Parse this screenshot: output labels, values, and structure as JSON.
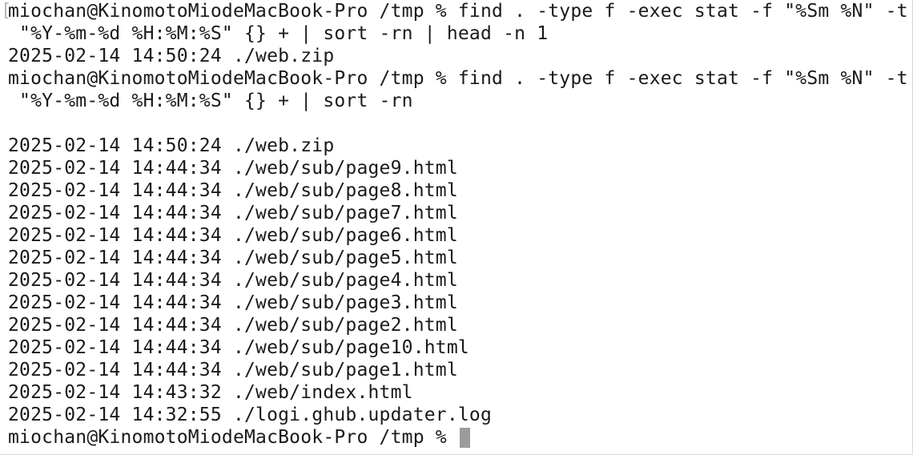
{
  "terminal": {
    "lines": [
      "miochan@KinomotoMiodeMacBook-Pro /tmp % find . -type f -exec stat -f \"%Sm %N\" -t",
      " \"%Y-%m-%d %H:%M:%S\" {} + | sort -rn | head -n 1",
      "2025-02-14 14:50:24 ./web.zip",
      "miochan@KinomotoMiodeMacBook-Pro /tmp % find . -type f -exec stat -f \"%Sm %N\" -t",
      " \"%Y-%m-%d %H:%M:%S\" {} + | sort -rn",
      "",
      "2025-02-14 14:50:24 ./web.zip",
      "2025-02-14 14:44:34 ./web/sub/page9.html",
      "2025-02-14 14:44:34 ./web/sub/page8.html",
      "2025-02-14 14:44:34 ./web/sub/page7.html",
      "2025-02-14 14:44:34 ./web/sub/page6.html",
      "2025-02-14 14:44:34 ./web/sub/page5.html",
      "2025-02-14 14:44:34 ./web/sub/page4.html",
      "2025-02-14 14:44:34 ./web/sub/page3.html",
      "2025-02-14 14:44:34 ./web/sub/page2.html",
      "2025-02-14 14:44:34 ./web/sub/page10.html",
      "2025-02-14 14:44:34 ./web/sub/page1.html",
      "2025-02-14 14:43:32 ./web/index.html",
      "2025-02-14 14:32:55 ./logi.ghub.updater.log"
    ],
    "prompt": "miochan@KinomotoMiodeMacBook-Pro /tmp % ",
    "bracket": "["
  },
  "colors": {
    "background": "#ffffff",
    "text": "#1a1a1a",
    "cursor": "#9b9b9b"
  }
}
